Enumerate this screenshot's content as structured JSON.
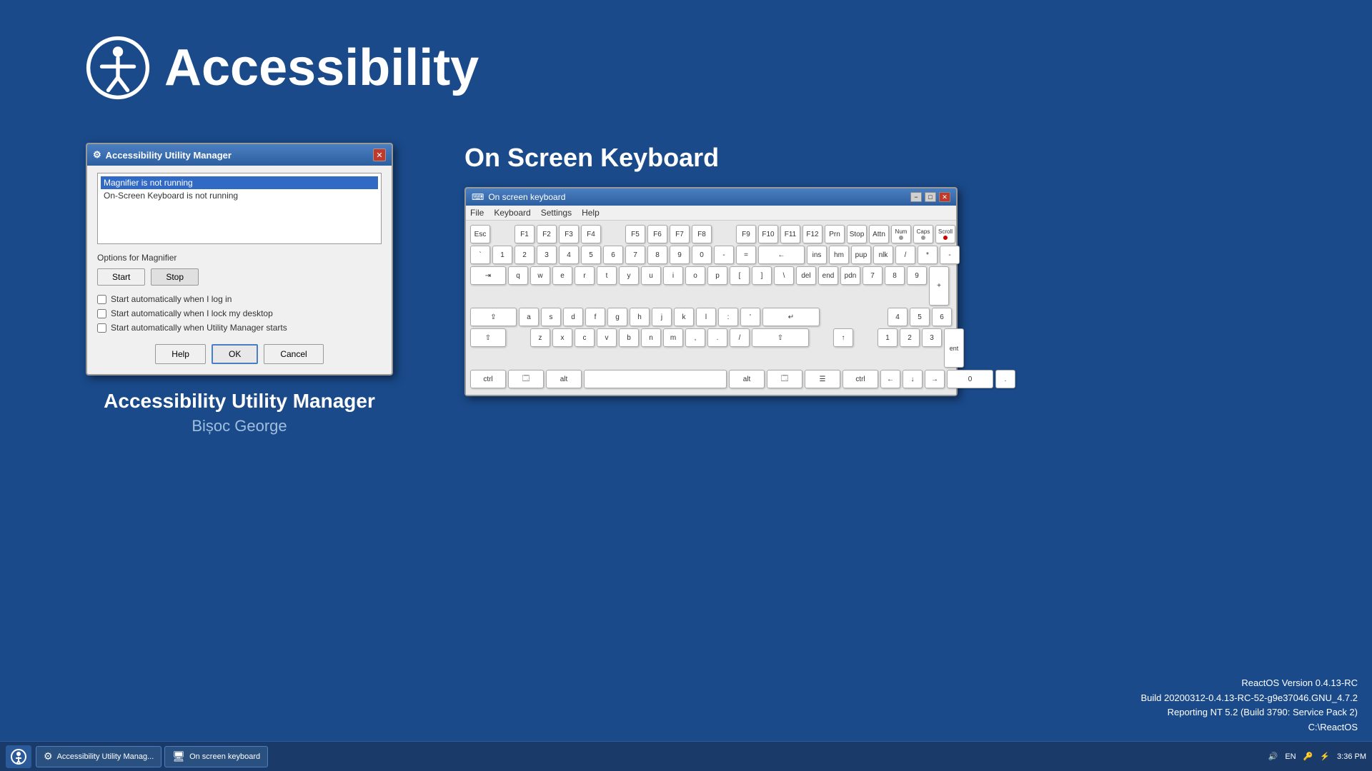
{
  "header": {
    "title": "Accessibility",
    "icon_label": "accessibility-icon"
  },
  "utility_manager": {
    "title": "Accessibility Utility Manager",
    "dialog_title": "Accessibility Utility Manager",
    "items": [
      {
        "text": "Magnifier is not running",
        "selected": true
      },
      {
        "text": "On-Screen Keyboard is not running",
        "selected": false
      }
    ],
    "options_label": "Options for Magnifier",
    "start_label": "Start",
    "stop_label": "Stop",
    "checkboxes": [
      "Start automatically when I log in",
      "Start automatically when I lock my desktop",
      "Start automatically when Utility Manager starts"
    ],
    "help_label": "Help",
    "ok_label": "OK",
    "cancel_label": "Cancel",
    "panel_title": "Accessibility Utility Manager",
    "panel_subtitle": "Bișoc George"
  },
  "osk": {
    "title": "On Screen Keyboard",
    "window_title": "On screen keyboard",
    "menu_items": [
      "File",
      "Keyboard",
      "Settings",
      "Help"
    ],
    "rows": {
      "row1": [
        "Esc",
        "",
        "F1",
        "F2",
        "F3",
        "F4",
        "",
        "F5",
        "F6",
        "F7",
        "F8",
        "",
        "F9",
        "F10",
        "F11",
        "F12",
        "Prn",
        "Stop",
        "Attn",
        "Num",
        "Caps",
        "Scroll"
      ],
      "row2": [
        "`",
        "1",
        "2",
        "3",
        "4",
        "5",
        "6",
        "7",
        "8",
        "9",
        "0",
        "-",
        "=",
        "",
        "←",
        "ins",
        "hm",
        "pup",
        "nlk",
        "/",
        "*",
        "-"
      ],
      "row3": [
        "⇥",
        "q",
        "w",
        "e",
        "r",
        "t",
        "y",
        "u",
        "i",
        "o",
        "p",
        "[",
        "]",
        "\\",
        "del",
        "end",
        "pdn",
        "7",
        "8",
        "9",
        "+"
      ],
      "row4": [
        "⇪",
        "a",
        "s",
        "d",
        "f",
        "g",
        "h",
        "j",
        "k",
        "l",
        ";",
        "'",
        "",
        "↵",
        "",
        "",
        "",
        "4",
        "5",
        "6"
      ],
      "row5": [
        "⇧",
        "",
        "z",
        "x",
        "c",
        "v",
        "b",
        "n",
        "m",
        ",",
        ".",
        "?",
        "",
        "⇧",
        "",
        "↑",
        "",
        "1",
        "2",
        "3",
        "ent"
      ],
      "row6": [
        "ctrl",
        "win",
        "alt",
        "",
        "",
        "",
        "",
        "alt",
        "win",
        "menu",
        "ctrl",
        "←",
        "↓",
        "→",
        "0",
        "."
      ]
    }
  },
  "taskbar": {
    "items": [
      {
        "label": "Accessibility Utility Manag...",
        "icon": "⚙"
      },
      {
        "label": "On screen keyboard",
        "icon": "🖥"
      }
    ],
    "time": "3:36 PM",
    "sys_icons": [
      "🔊",
      "EN",
      "🔒"
    ]
  },
  "version": {
    "line1": "ReactOS Version 0.4.13-RC",
    "line2": "Build 20200312-0.4.13-RC-52-g9e37046.GNU_4.7.2",
    "line3": "Reporting NT 5.2 (Build 3790: Service Pack 2)",
    "line4": "C:\\ReactOS"
  }
}
